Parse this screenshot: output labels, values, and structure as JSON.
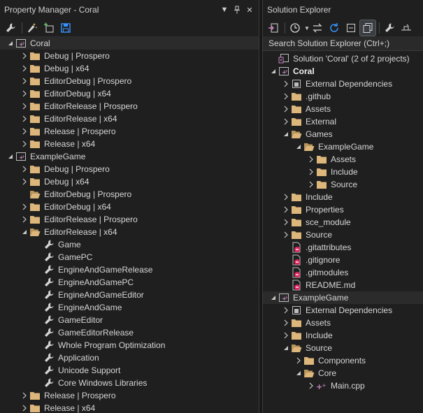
{
  "property_manager": {
    "title": "Property Manager - Coral",
    "tree": [
      {
        "label": "Coral",
        "level": 0,
        "type": "project",
        "caret": "open",
        "sel": true
      },
      {
        "label": "Debug | Prospero",
        "level": 1,
        "type": "folder",
        "caret": "closed"
      },
      {
        "label": "Debug | x64",
        "level": 1,
        "type": "folder",
        "caret": "closed"
      },
      {
        "label": "EditorDebug | Prospero",
        "level": 1,
        "type": "folder",
        "caret": "closed"
      },
      {
        "label": "EditorDebug | x64",
        "level": 1,
        "type": "folder",
        "caret": "closed"
      },
      {
        "label": "EditorRelease | Prospero",
        "level": 1,
        "type": "folder",
        "caret": "closed"
      },
      {
        "label": "EditorRelease | x64",
        "level": 1,
        "type": "folder",
        "caret": "closed"
      },
      {
        "label": "Release | Prospero",
        "level": 1,
        "type": "folder",
        "caret": "closed"
      },
      {
        "label": "Release | x64",
        "level": 1,
        "type": "folder",
        "caret": "closed"
      },
      {
        "label": "ExampleGame",
        "level": 0,
        "type": "project",
        "caret": "open"
      },
      {
        "label": "Debug | Prospero",
        "level": 1,
        "type": "folder",
        "caret": "closed"
      },
      {
        "label": "Debug | x64",
        "level": 1,
        "type": "folder",
        "caret": "closed"
      },
      {
        "label": "EditorDebug | Prospero",
        "level": 1,
        "type": "folder-open",
        "caret": "none"
      },
      {
        "label": "EditorDebug | x64",
        "level": 1,
        "type": "folder",
        "caret": "closed"
      },
      {
        "label": "EditorRelease | Prospero",
        "level": 1,
        "type": "folder",
        "caret": "closed"
      },
      {
        "label": "EditorRelease | x64",
        "level": 1,
        "type": "folder-open",
        "caret": "open"
      },
      {
        "label": "Game",
        "level": 2,
        "type": "wrench",
        "caret": "none"
      },
      {
        "label": "GamePC",
        "level": 2,
        "type": "wrench",
        "caret": "none"
      },
      {
        "label": "EngineAndGameRelease",
        "level": 2,
        "type": "wrench",
        "caret": "none"
      },
      {
        "label": "EngineAndGamePC",
        "level": 2,
        "type": "wrench",
        "caret": "none"
      },
      {
        "label": "EngineAndGameEditor",
        "level": 2,
        "type": "wrench",
        "caret": "none"
      },
      {
        "label": "EngineAndGame",
        "level": 2,
        "type": "wrench",
        "caret": "none"
      },
      {
        "label": "GameEditor",
        "level": 2,
        "type": "wrench",
        "caret": "none"
      },
      {
        "label": "GameEditorRelease",
        "level": 2,
        "type": "wrench",
        "caret": "none"
      },
      {
        "label": "Whole Program Optimization",
        "level": 2,
        "type": "wrench",
        "caret": "none"
      },
      {
        "label": "Application",
        "level": 2,
        "type": "wrench",
        "caret": "none"
      },
      {
        "label": "Unicode Support",
        "level": 2,
        "type": "wrench",
        "caret": "none"
      },
      {
        "label": "Core Windows Libraries",
        "level": 2,
        "type": "wrench",
        "caret": "none"
      },
      {
        "label": "Release | Prospero",
        "level": 1,
        "type": "folder",
        "caret": "closed"
      },
      {
        "label": "Release | x64",
        "level": 1,
        "type": "folder",
        "caret": "closed"
      }
    ]
  },
  "solution_explorer": {
    "title": "Solution Explorer",
    "search_placeholder": "Search Solution Explorer (Ctrl+;)",
    "tree": [
      {
        "label": "Solution 'Coral' (2 of 2 projects)",
        "level": 0,
        "type": "solution",
        "caret": "none"
      },
      {
        "label": "Coral",
        "level": 0,
        "type": "project",
        "caret": "open",
        "bold": true
      },
      {
        "label": "External Dependencies",
        "level": 1,
        "type": "extdeps",
        "caret": "closed"
      },
      {
        "label": ".github",
        "level": 1,
        "type": "folder",
        "caret": "closed"
      },
      {
        "label": "Assets",
        "level": 1,
        "type": "folder",
        "caret": "closed"
      },
      {
        "label": "External",
        "level": 1,
        "type": "folder",
        "caret": "closed"
      },
      {
        "label": "Games",
        "level": 1,
        "type": "folder-open",
        "caret": "open"
      },
      {
        "label": "ExampleGame",
        "level": 2,
        "type": "folder-open",
        "caret": "open"
      },
      {
        "label": "Assets",
        "level": 3,
        "type": "folder",
        "caret": "closed"
      },
      {
        "label": "Include",
        "level": 3,
        "type": "folder",
        "caret": "closed"
      },
      {
        "label": "Source",
        "level": 3,
        "type": "folder",
        "caret": "closed"
      },
      {
        "label": "Include",
        "level": 1,
        "type": "folder",
        "caret": "closed"
      },
      {
        "label": "Properties",
        "level": 1,
        "type": "folder",
        "caret": "closed"
      },
      {
        "label": "sce_module",
        "level": 1,
        "type": "folder",
        "caret": "closed"
      },
      {
        "label": "Source",
        "level": 1,
        "type": "folder",
        "caret": "closed"
      },
      {
        "label": ".gitattributes",
        "level": 1,
        "type": "gitfile",
        "caret": "none"
      },
      {
        "label": ".gitignore",
        "level": 1,
        "type": "gitfile",
        "caret": "none"
      },
      {
        "label": ".gitmodules",
        "level": 1,
        "type": "gitfile",
        "caret": "none"
      },
      {
        "label": "README.md",
        "level": 1,
        "type": "gitfile",
        "caret": "none"
      },
      {
        "label": "ExampleGame",
        "level": 0,
        "type": "project",
        "caret": "open",
        "sel": true
      },
      {
        "label": "External Dependencies",
        "level": 1,
        "type": "extdeps",
        "caret": "closed"
      },
      {
        "label": "Assets",
        "level": 1,
        "type": "folder",
        "caret": "closed"
      },
      {
        "label": "Include",
        "level": 1,
        "type": "folder",
        "caret": "closed"
      },
      {
        "label": "Source",
        "level": 1,
        "type": "folder-open",
        "caret": "open"
      },
      {
        "label": "Components",
        "level": 2,
        "type": "folder",
        "caret": "closed"
      },
      {
        "label": "Core",
        "level": 2,
        "type": "folder-open",
        "caret": "open"
      },
      {
        "label": "Main.cpp",
        "level": 3,
        "type": "cpp",
        "caret": "closed"
      }
    ]
  },
  "colors": {
    "folder": "#dcb67a",
    "project": "#c586c0",
    "accent": "#3794ff",
    "git_red": "#e0245e"
  }
}
